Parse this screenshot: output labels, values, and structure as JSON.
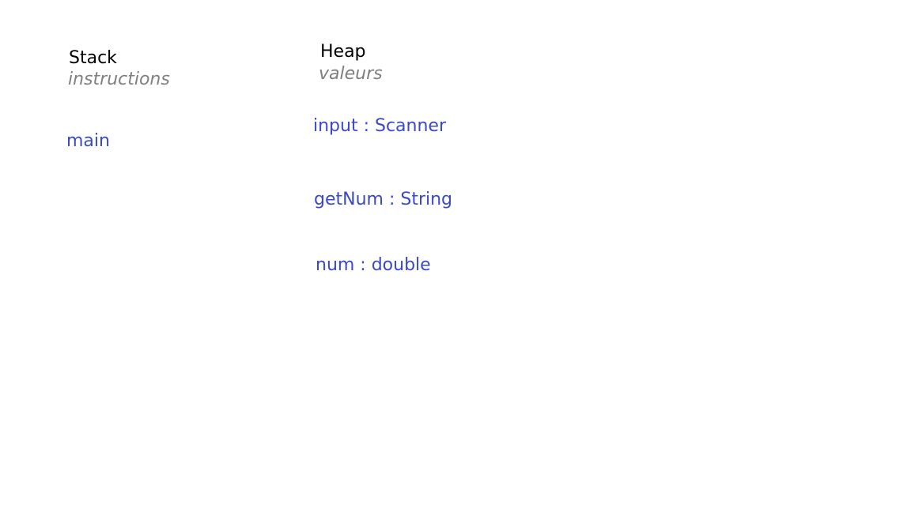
{
  "stack": {
    "title": "Stack",
    "subtitle": "instructions",
    "items": [
      "main"
    ]
  },
  "heap": {
    "title": "Heap",
    "subtitle": "valeurs",
    "items": [
      "input : Scanner",
      "getNum : String",
      "num : double"
    ]
  },
  "colors": {
    "title": "#000000",
    "subtitle": "#7f7f7f",
    "item": "#3b48c8",
    "background": "#ffffff"
  }
}
